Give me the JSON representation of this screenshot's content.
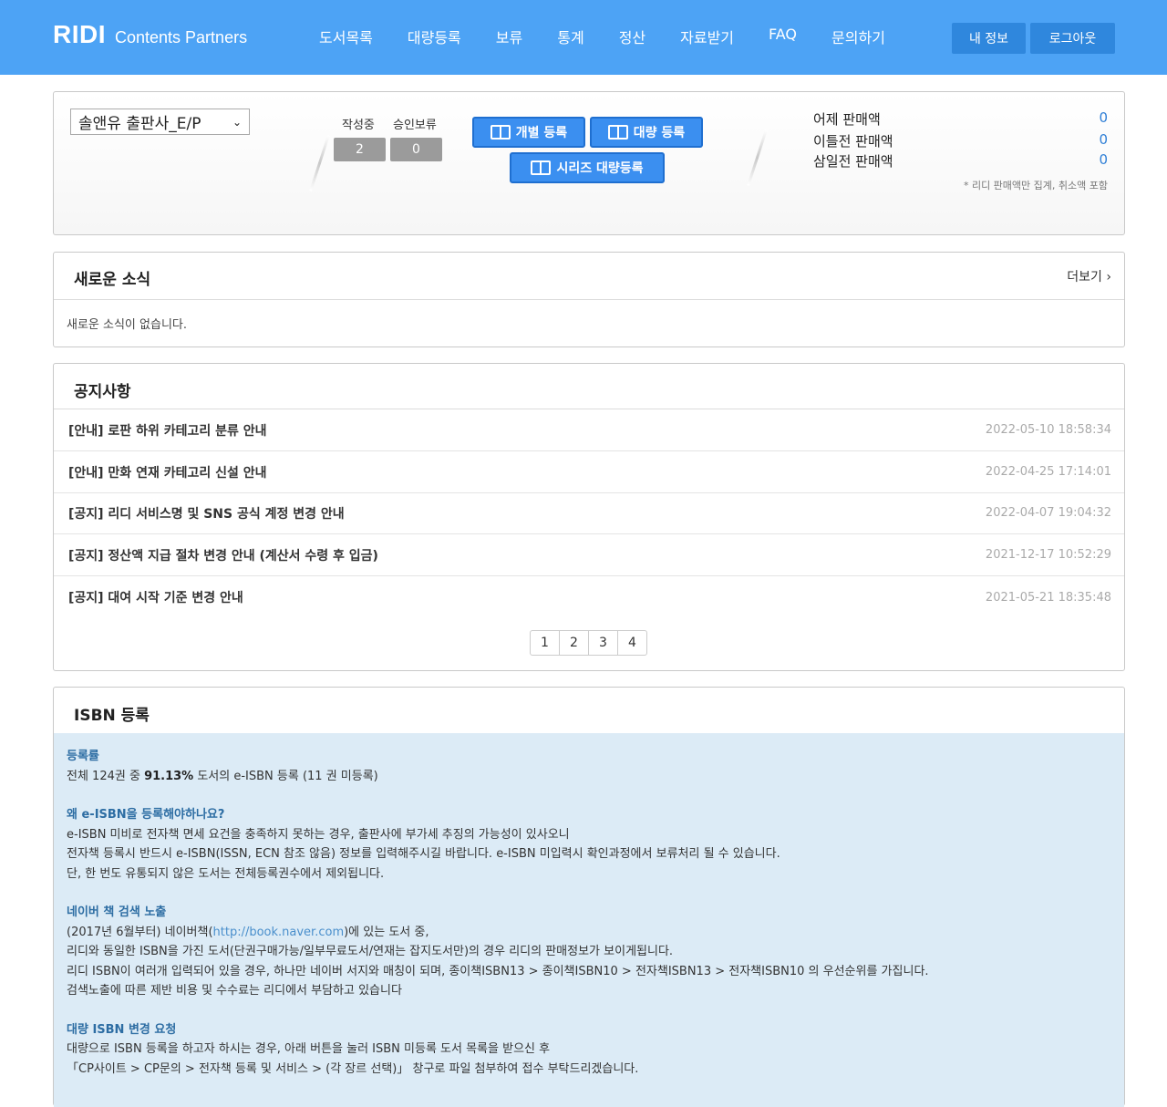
{
  "header": {
    "brand": "RIDI",
    "brand_sub": "Contents Partners",
    "nav": [
      "도서목록",
      "대량등록",
      "보류",
      "통계",
      "정산",
      "자료받기",
      "FAQ",
      "문의하기"
    ],
    "my_info": "내 정보",
    "logout": "로그아웃"
  },
  "summary": {
    "publisher": "솔앤유 출판사_E/P",
    "drafting_label": "작성중",
    "drafting_count": "2",
    "pending_label": "승인보류",
    "pending_count": "0",
    "single_register": "개별 등록",
    "bulk_register": "대량 등록",
    "series_register": "시리즈 대량등록",
    "sales": [
      {
        "label": "어제 판매액",
        "value": "0"
      },
      {
        "label": "이틀전 판매액",
        "value": "0"
      },
      {
        "label": "삼일전 판매액",
        "value": "0"
      }
    ],
    "note": "* 리디 판매액만 집계, 취소액 포함"
  },
  "news": {
    "title": "새로운 소식",
    "more": "더보기",
    "empty": "새로운 소식이 없습니다."
  },
  "notice": {
    "title": "공지사항",
    "items": [
      {
        "title": "[안내] 로판 하위 카테고리 분류 안내",
        "date": "2022-05-10 18:58:34"
      },
      {
        "title": "[안내] 만화 연재 카테고리 신설 안내",
        "date": "2022-04-25 17:14:01"
      },
      {
        "title": "[공지] 리디 서비스명 및 SNS 공식 계정 변경 안내",
        "date": "2022-04-07 19:04:32"
      },
      {
        "title": "[공지] 정산액 지급 절차 변경 안내 (계산서 수령 후 입금)",
        "date": "2021-12-17 10:52:29"
      },
      {
        "title": "[공지] 대여 시작 기준 변경 안내",
        "date": "2021-05-21 18:35:48"
      }
    ],
    "pages": [
      "1",
      "2",
      "3",
      "4"
    ]
  },
  "isbn": {
    "title": "ISBN 등록",
    "rate_heading": "등록률",
    "rate_pre": "전체 124권 중 ",
    "rate_value": "91.13%",
    "rate_post": " 도서의 e-ISBN 등록 (11 권 미등록)",
    "why_heading": "왜 e-ISBN을 등록해야하나요?",
    "why_lines": [
      "e-ISBN 미비로 전자책 면세 요건을 충족하지 못하는 경우, 출판사에 부가세 추징의 가능성이 있사오니",
      "전자책 등록시 반드시 e-ISBN(ISSN, ECN 참조 않음) 정보를 입력해주시길 바랍니다. e-ISBN 미입력시 확인과정에서 보류처리 될 수 있습니다.",
      "단, 한 번도 유통되지 않은 도서는 전체등록권수에서 제외됩니다."
    ],
    "naver_heading": "네이버 책 검색 노출",
    "naver_pre": "(2017년 6월부터) 네이버책(",
    "naver_link": "http://book.naver.com",
    "naver_post": ")에 있는 도서 중,",
    "naver_lines": [
      "리디와 동일한 ISBN을 가진 도서(단권구매가능/일부무료도서/연재는 잡지도서만)의 경우 리디의 판매정보가 보이게됩니다.",
      "리디 ISBN이 여러개 입력되어 있을 경우, 하나만 네이버 서지와 매칭이 되며, 종이책ISBN13 > 종이책ISBN10 > 전자책ISBN13 > 전자책ISBN10 의 우선순위를 가집니다.",
      "검색노출에 따른 제반 비용 및 수수료는 리디에서 부담하고 있습니다"
    ],
    "bulk_heading": "대량 ISBN 변경 요청",
    "bulk_lines": [
      "대량으로 ISBN 등록을 하고자 하시는 경우, 아래 버튼을 눌러 ISBN 미등록 도서 목록을 받으신 후",
      "「CP사이트 > CP문의 > 전자책 등록 및 서비스 > (각 장르 선택)」 창구로 파일 첨부하여 접수 부탁드리겠습니다."
    ]
  }
}
